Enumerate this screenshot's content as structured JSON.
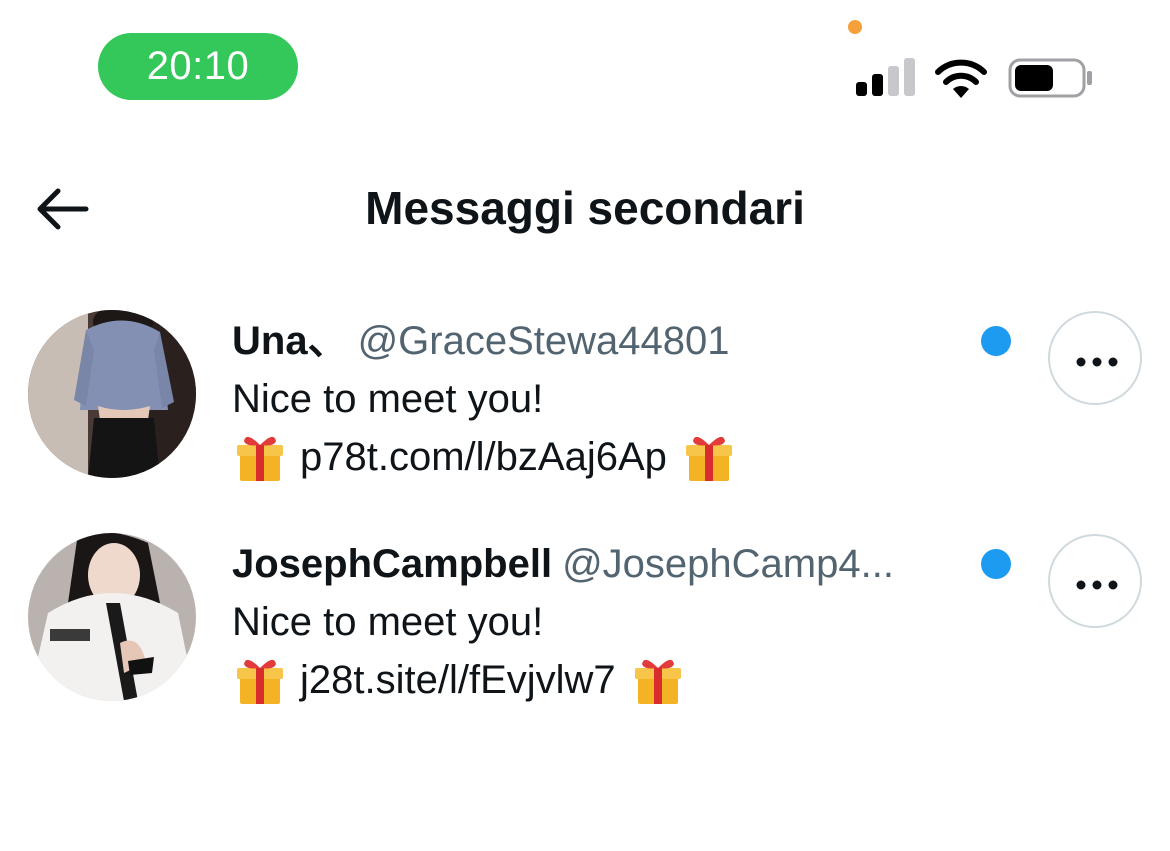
{
  "status_bar": {
    "time": "20:10",
    "time_pill_color": "#34c759",
    "mic_indicator_color": "#f5a03a",
    "signal_bars_active": 2,
    "signal_bars_total": 4,
    "battery_level": 0.55,
    "icons": [
      "cellular-signal-icon",
      "wifi-icon",
      "battery-icon"
    ]
  },
  "header": {
    "back_icon": "arrow-left-icon",
    "title": "Messaggi secondari"
  },
  "conversations": [
    {
      "name": "Una、",
      "handle": "@GraceStewa44801",
      "message_line_1": "Nice to meet you!",
      "link": "p78t.com/l/bzAaj6Ap",
      "unread": true,
      "avatar": "avatar-photo"
    },
    {
      "name": "JosephCampbell",
      "handle": "@JosephCamp4...",
      "message_line_1": "Nice to meet you!",
      "link": "j28t.site/l/fEvjvlw7",
      "unread": true,
      "avatar": "avatar-photo"
    }
  ],
  "colors": {
    "accent_blue": "#1d9bf0",
    "text_primary": "#0f1419",
    "text_secondary": "#536471",
    "border": "#cfd9de"
  },
  "icons": {
    "gift": "wrapped-gift-emoji",
    "more": "more-horizontal-icon"
  }
}
